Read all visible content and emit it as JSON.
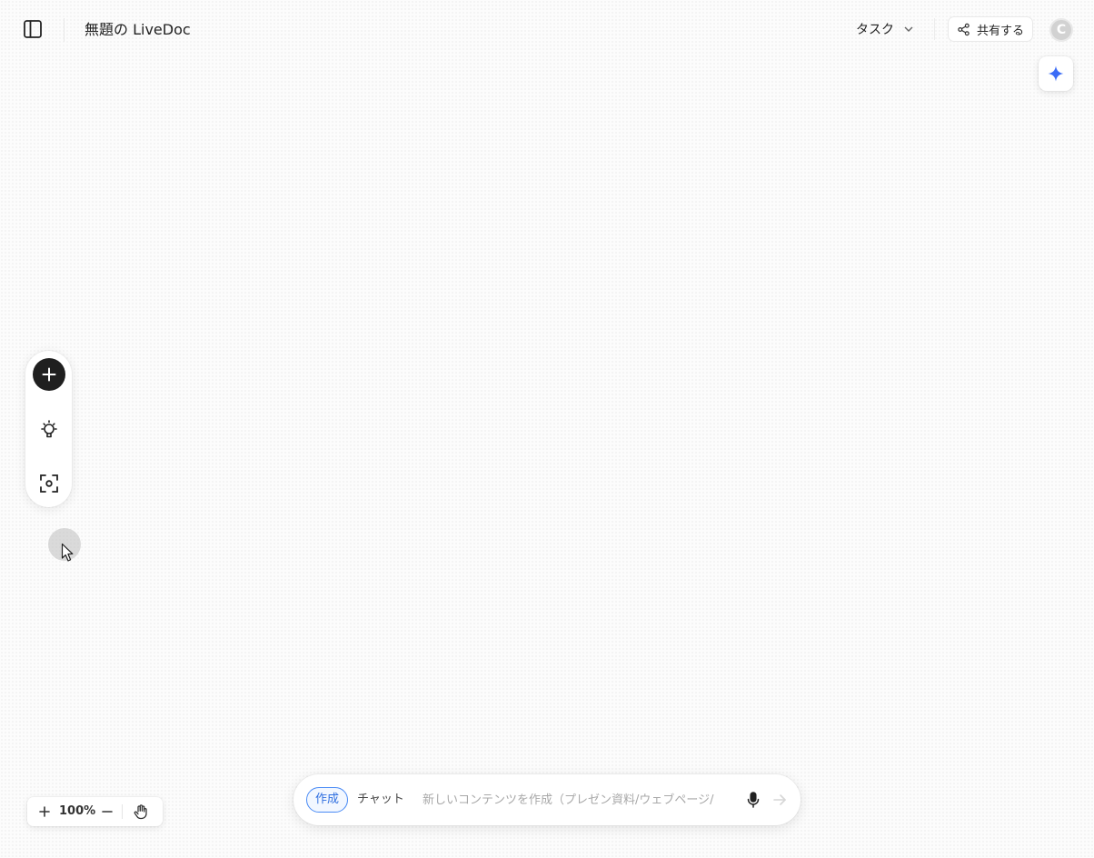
{
  "header": {
    "title": "無題の LiveDoc",
    "task_label": "タスク",
    "share_label": "共有する",
    "avatar_initial": "C"
  },
  "canvas": {
    "zoom_level": "100%"
  },
  "composer": {
    "mode_create_label": "作成",
    "mode_chat_label": "チャット",
    "placeholder": "新しいコンテンツを作成（プレゼン資料/ウェブページ/",
    "active_mode": "作成"
  },
  "icons": {
    "sidebar_toggle": "sidebar-toggle-icon",
    "task_chevron": "chevron-down-icon",
    "share": "share-icon",
    "ai_assistant": "sparkle-icon",
    "add": "plus-icon",
    "ideas": "lightbulb-icon",
    "capture": "scan-focus-icon",
    "zoom_in": "plus-icon",
    "zoom_out": "minus-icon",
    "hand": "hand-icon",
    "mic": "microphone-icon",
    "send": "arrow-right-icon"
  },
  "colors": {
    "accent": "#2f6fe0",
    "ai_sparkle": "#3b6cf6",
    "add_button": "#1f1f1f",
    "avatar_bg": "#d2d2d2"
  }
}
